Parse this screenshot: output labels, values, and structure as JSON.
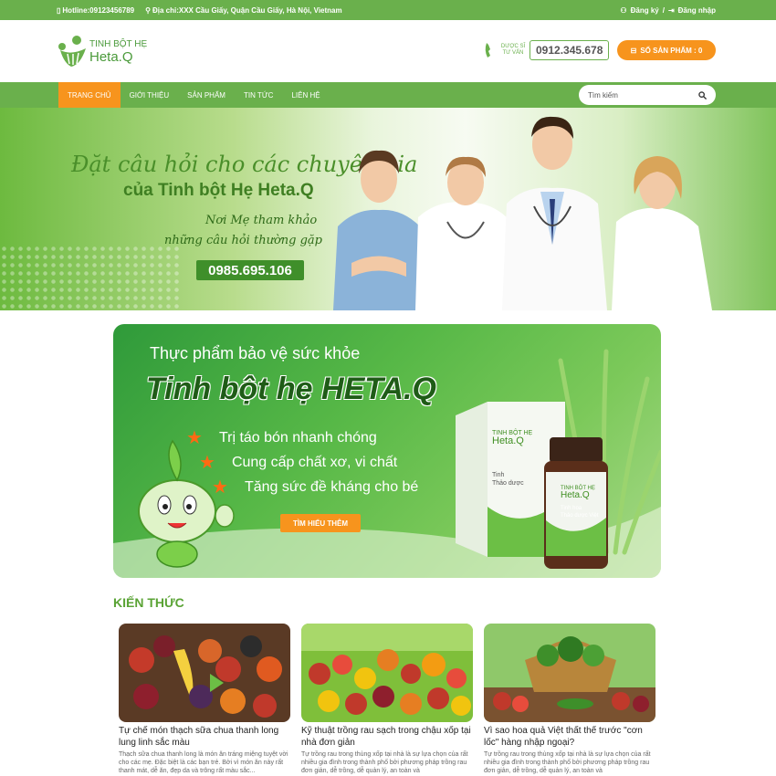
{
  "topbar": {
    "hotline": "Hotline:09123456789",
    "address": "Địa chỉ:XXX Cầu Giấy, Quận Cầu Giấy, Hà Nội, Vietnam",
    "register": "Đăng ký",
    "separator": "/",
    "login": "Đăng nhập"
  },
  "header": {
    "logo_line1": "TINH BỘT HẸ",
    "logo_line2": "Heta.Q",
    "hotline_tag_1": "DƯỢC SĨ",
    "hotline_tag_2": "TƯ VẤN",
    "hotline_number": "0912.345.678",
    "cart_label": "SỐ SẢN PHẨM : 0"
  },
  "nav": {
    "items": [
      "Trang chủ",
      "Giới thiệu",
      "Sản phẩm",
      "Tin tức",
      "Liên hệ"
    ],
    "search_placeholder": "Tìm kiếm"
  },
  "hero": {
    "line1": "Đặt câu hỏi cho các chuyên gia",
    "line2": "của Tinh bột Hẹ Heta.Q",
    "line3": "Nơi Mẹ tham khảo",
    "line4": "những câu hỏi thường gặp",
    "phone": "0985.695.106"
  },
  "promo": {
    "subtitle": "Thực phẩm bảo vệ sức khỏe",
    "title": "Tinh bột hẹ HETA.Q",
    "bullets": [
      "Trị táo bón nhanh chóng",
      "Cung cấp chất xơ, vi chất",
      "Tăng sức đề kháng cho bé"
    ],
    "button": "TÌM HIỂU THÊM",
    "box_label_1": "TINH BỘT HẸ",
    "box_label_2": "Heta.Q",
    "box_sub_1": "Tinh",
    "box_sub_2": "Thảo dược",
    "jar_label_1": "TINH BỘT HẸ",
    "jar_label_2": "Heta.Q",
    "jar_sub_1": "Tinh hoa",
    "jar_sub_2": "Thảo dược Việt"
  },
  "section_title": "KIẾN THỨC",
  "articles": [
    {
      "title": "Tự chế món thạch sữa chua thanh long lung linh sắc màu",
      "desc": "Thạch sữa chua thanh long là món ăn tráng miệng tuyệt vời cho các mẹ. Đặc biệt là các bạn trẻ. Bởi vì món ăn này rất thanh mát, dễ ăn, đẹp da và trông rất màu sắc..."
    },
    {
      "title": "Kỹ thuật trồng rau sạch trong chậu xốp tại nhà đơn giản",
      "desc": "Tự trồng rau trong thùng xốp tại nhà là sự lựa chọn của rất nhiều gia đình trong thành phố bởi phương pháp trồng rau đơn giản, dễ trồng, dễ quản lý, an toàn và"
    },
    {
      "title": "Vì sao hoa quả Việt thất thế trước \"cơn lốc\" hàng nhập ngoại?",
      "desc": "Tự trồng rau trong thùng xốp tại nhà là sự lựa chọn của rất nhiều gia đình trong thành phố bởi phương pháp trồng rau đơn giản, dễ trồng, dễ quản lý, an toàn và"
    }
  ]
}
